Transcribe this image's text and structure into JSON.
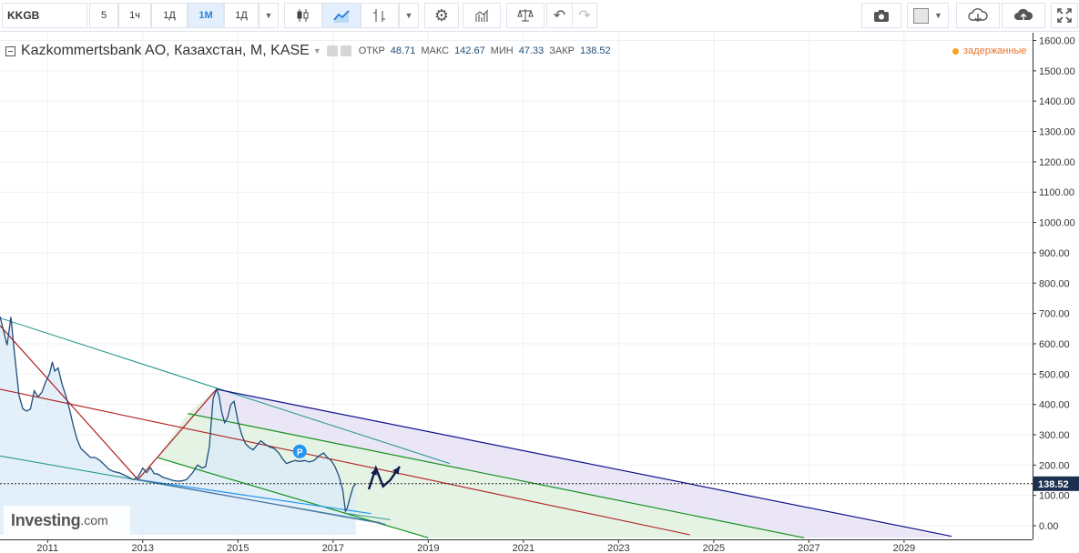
{
  "toolbar": {
    "symbol": "KKGB",
    "intervals": [
      {
        "label": "5",
        "active": false
      },
      {
        "label": "1ч",
        "active": false
      },
      {
        "label": "1Д",
        "active": false
      },
      {
        "label": "1М",
        "active": true
      },
      {
        "label": "1Д",
        "active": false
      }
    ],
    "icons": [
      "chevron-down-icon",
      "candlestick-icon",
      "area-chart-icon",
      "bar-chart-icon",
      "chevron-down-icon",
      "gear-icon",
      "indicators-icon",
      "scales-icon",
      "undo-icon",
      "redo-icon",
      "camera-icon",
      "color-square-icon",
      "chevron-down-icon",
      "cloud-download-icon",
      "cloud-upload-icon",
      "fullscreen-icon"
    ]
  },
  "header": {
    "title": "Kazkommertsbank AO, Казахстан, M, KASE",
    "open_label": "ОТКР",
    "open": "48.71",
    "high_label": "МАКС",
    "high": "142.67",
    "low_label": "МИН",
    "low": "47.33",
    "close_label": "ЗАКР",
    "close": "138.52",
    "delayed": "задержанные"
  },
  "watermark": {
    "brand": "Investing",
    "suffix": ".com"
  },
  "chart_data": {
    "type": "line",
    "y_ticks": [
      "1600.00",
      "1500.00",
      "1400.00",
      "1300.00",
      "1200.00",
      "1100.00",
      "1000.00",
      "900.00",
      "800.00",
      "700.00",
      "600.00",
      "500.00",
      "400.00",
      "300.00",
      "200.00",
      "100.00",
      "0.00"
    ],
    "x_ticks": [
      "2011",
      "2013",
      "2015",
      "2017",
      "2019",
      "2021",
      "2023",
      "2025",
      "2027",
      "2029"
    ],
    "ylim": [
      -30,
      1610
    ],
    "xlim": [
      2010.0,
      2031.7
    ],
    "last_price": "138.52",
    "last_price_value": 138.52,
    "marker_label": "P",
    "colors": {
      "price_line": "#1f4e79",
      "price_fill": "#dcebf8",
      "outer_channel": "#0f0f8c",
      "mid_channel": "#b01c1c",
      "inner_channel": "#14911e",
      "teal": "#2a9a8f",
      "accent_blue": "#2196f3"
    },
    "series": [
      {
        "values": [
          [
            2010.0,
            690
          ],
          [
            2010.08,
            640
          ],
          [
            2010.15,
            595
          ],
          [
            2010.23,
            688
          ],
          [
            2010.31,
            560
          ],
          [
            2010.4,
            430
          ],
          [
            2010.48,
            385
          ],
          [
            2010.56,
            378
          ],
          [
            2010.64,
            385
          ],
          [
            2010.72,
            445
          ],
          [
            2010.8,
            425
          ],
          [
            2010.88,
            440
          ],
          [
            2010.96,
            475
          ],
          [
            2011.04,
            500
          ],
          [
            2011.1,
            540
          ],
          [
            2011.15,
            510
          ],
          [
            2011.22,
            520
          ],
          [
            2011.3,
            470
          ],
          [
            2011.38,
            430
          ],
          [
            2011.46,
            385
          ],
          [
            2011.54,
            330
          ],
          [
            2011.62,
            285
          ],
          [
            2011.7,
            255
          ],
          [
            2011.8,
            240
          ],
          [
            2011.9,
            225
          ],
          [
            2012.0,
            225
          ],
          [
            2012.1,
            215
          ],
          [
            2012.2,
            200
          ],
          [
            2012.3,
            185
          ],
          [
            2012.4,
            178
          ],
          [
            2012.5,
            175
          ],
          [
            2012.6,
            168
          ],
          [
            2012.7,
            160
          ],
          [
            2012.8,
            152
          ],
          [
            2012.9,
            160
          ],
          [
            2013.0,
            190
          ],
          [
            2013.08,
            175
          ],
          [
            2013.16,
            192
          ],
          [
            2013.24,
            172
          ],
          [
            2013.32,
            170
          ],
          [
            2013.42,
            160
          ],
          [
            2013.52,
            155
          ],
          [
            2013.62,
            150
          ],
          [
            2013.72,
            147
          ],
          [
            2013.82,
            148
          ],
          [
            2013.92,
            152
          ],
          [
            2014.05,
            175
          ],
          [
            2014.15,
            200
          ],
          [
            2014.25,
            190
          ],
          [
            2014.32,
            195
          ],
          [
            2014.4,
            260
          ],
          [
            2014.48,
            420
          ],
          [
            2014.55,
            450
          ],
          [
            2014.6,
            430
          ],
          [
            2014.66,
            375
          ],
          [
            2014.72,
            340
          ],
          [
            2014.78,
            355
          ],
          [
            2014.85,
            400
          ],
          [
            2014.92,
            410
          ],
          [
            2015.0,
            345
          ],
          [
            2015.08,
            300
          ],
          [
            2015.16,
            270
          ],
          [
            2015.24,
            258
          ],
          [
            2015.32,
            250
          ],
          [
            2015.4,
            265
          ],
          [
            2015.48,
            280
          ],
          [
            2015.56,
            270
          ],
          [
            2015.66,
            260
          ],
          [
            2015.76,
            255
          ],
          [
            2015.86,
            240
          ],
          [
            2015.94,
            220
          ],
          [
            2016.02,
            205
          ],
          [
            2016.1,
            210
          ],
          [
            2016.2,
            215
          ],
          [
            2016.3,
            212
          ],
          [
            2016.4,
            215
          ],
          [
            2016.5,
            210
          ],
          [
            2016.6,
            215
          ],
          [
            2016.7,
            230
          ],
          [
            2016.8,
            240
          ],
          [
            2016.88,
            225
          ],
          [
            2016.96,
            215
          ],
          [
            2017.04,
            195
          ],
          [
            2017.12,
            165
          ],
          [
            2017.2,
            120
          ],
          [
            2017.26,
            48
          ],
          [
            2017.3,
            60
          ],
          [
            2017.36,
            95
          ],
          [
            2017.42,
            128
          ],
          [
            2017.48,
            138.52
          ]
        ]
      }
    ],
    "annotations": [
      {
        "type": "channel",
        "from": [
          2010.0,
          685
        ],
        "to": [
          2019.5,
          205
        ]
      },
      {
        "type": "channel",
        "from": [
          2012.9,
          152
        ],
        "to": [
          2014.5,
          450
        ]
      },
      {
        "type": "arrow",
        "path": [
          [
            2017.75,
            120
          ],
          [
            2017.9,
            190
          ],
          [
            2018.05,
            130
          ],
          [
            2018.2,
            150
          ],
          [
            2018.4,
            195
          ]
        ]
      }
    ]
  }
}
